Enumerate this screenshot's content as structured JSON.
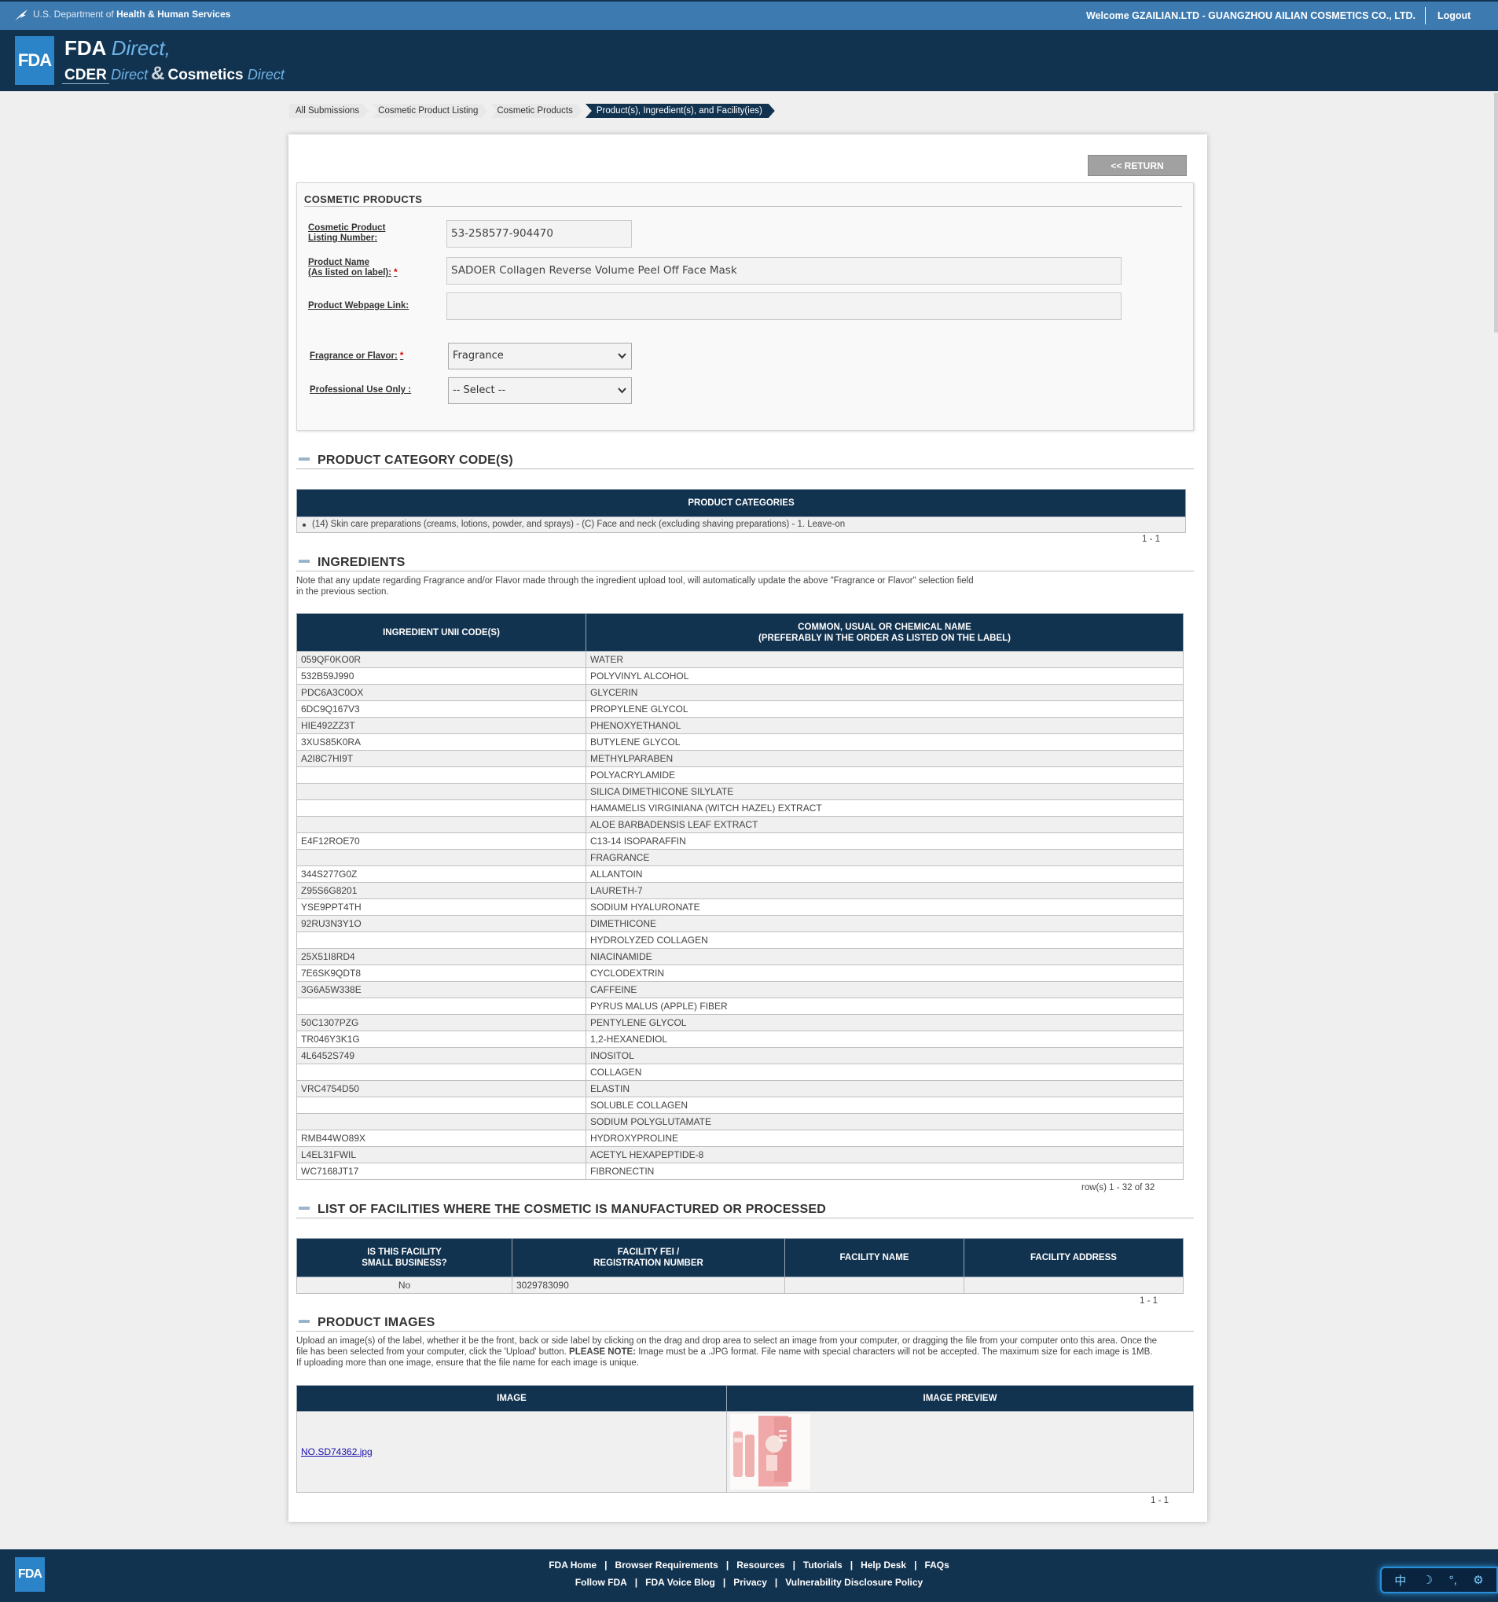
{
  "header": {
    "agency": "U.S. Department of",
    "agency_bold": "Health & Human Services",
    "welcome": "Welcome GZAILIAN.LTD - GUANGZHOU AILIAN COSMETICS CO., LTD.",
    "logout": "Logout"
  },
  "brand": {
    "logo": "FDA",
    "fda": "FDA",
    "direct": "Direct,",
    "cder": "CDER",
    "direct2": "Direct",
    "amp": "&",
    "cosmetics": "Cosmetics",
    "direct3": "Direct"
  },
  "breadcrumb": [
    "All Submissions",
    "Cosmetic Product Listing",
    "Cosmetic Products",
    "Product(s), Ingredient(s), and Facility(ies)"
  ],
  "return_label": "<< RETURN",
  "cosmetic_products": {
    "title": "COSMETIC PRODUCTS",
    "listing_label_1": "Cosmetic Product",
    "listing_label_2": "Listing Number:",
    "listing_value": "53-258577-904470",
    "name_label_1": "Product Name",
    "name_label_2": "(As listed on label):",
    "name_value": "SADOER Collagen Reverse Volume Peel Off Face Mask",
    "webpage_label": "Product Webpage Link:",
    "webpage_value": "",
    "fragrance_label": "Fragrance or Flavor:",
    "fragrance_value": "Fragrance",
    "professional_label": "Professional Use Only :",
    "professional_value": "-- Select --",
    "required_mark": "*"
  },
  "category": {
    "heading": "PRODUCT CATEGORY CODE(S)",
    "col_header": "PRODUCT CATEGORIES",
    "item": "(14) Skin care preparations (creams, lotions, powder, and sprays) - (C) Face and neck (excluding shaving preparations) - 1. Leave-on",
    "pager": "1 - 1"
  },
  "ingredients": {
    "heading": "INGREDIENTS",
    "note_1": "Note that any update regarding Fragrance and/or Flavor made through the ingredient upload tool, will automatically update the above \"Fragrance or Flavor\" selection field",
    "note_2": "in the previous section.",
    "col1": "INGREDIENT UNII CODE(S)",
    "col2_1": "COMMON, USUAL OR CHEMICAL NAME",
    "col2_2": "(PREFERABLY IN THE ORDER AS LISTED ON THE LABEL)",
    "rows": [
      [
        "059QF0KO0R",
        "WATER"
      ],
      [
        "532B59J990",
        "POLYVINYL ALCOHOL"
      ],
      [
        "PDC6A3C0OX",
        "GLYCERIN"
      ],
      [
        "6DC9Q167V3",
        "PROPYLENE GLYCOL"
      ],
      [
        "HIE492ZZ3T",
        "PHENOXYETHANOL"
      ],
      [
        "3XUS85K0RA",
        "BUTYLENE GLYCOL"
      ],
      [
        "A2I8C7HI9T",
        "METHYLPARABEN"
      ],
      [
        "",
        "POLYACRYLAMIDE"
      ],
      [
        "",
        "SILICA DIMETHICONE SILYLATE"
      ],
      [
        "",
        "HAMAMELIS VIRGINIANA (WITCH HAZEL) EXTRACT"
      ],
      [
        "",
        "ALOE BARBADENSIS LEAF EXTRACT"
      ],
      [
        "E4F12ROE70",
        "C13-14 ISOPARAFFIN"
      ],
      [
        "",
        "FRAGRANCE"
      ],
      [
        "344S277G0Z",
        "ALLANTOIN"
      ],
      [
        "Z95S6G8201",
        "LAURETH-7"
      ],
      [
        "YSE9PPT4TH",
        "SODIUM HYALURONATE"
      ],
      [
        "92RU3N3Y1O",
        "DIMETHICONE"
      ],
      [
        "",
        "HYDROLYZED COLLAGEN"
      ],
      [
        "25X51I8RD4",
        "NIACINAMIDE"
      ],
      [
        "7E6SK9QDT8",
        "CYCLODEXTRIN"
      ],
      [
        "3G6A5W338E",
        "CAFFEINE"
      ],
      [
        "",
        "PYRUS MALUS (APPLE) FIBER"
      ],
      [
        "50C1307PZG",
        "PENTYLENE GLYCOL"
      ],
      [
        "TR046Y3K1G",
        "1,2-HEXANEDIOL"
      ],
      [
        "4L6452S749",
        "INOSITOL"
      ],
      [
        "",
        "COLLAGEN"
      ],
      [
        "VRC4754D50",
        "ELASTIN"
      ],
      [
        "",
        "SOLUBLE COLLAGEN"
      ],
      [
        "",
        "SODIUM POLYGLUTAMATE"
      ],
      [
        "RMB44WO89X",
        "HYDROXYPROLINE"
      ],
      [
        "L4EL31FWIL",
        "ACETYL HEXAPEPTIDE-8"
      ],
      [
        "WC7168JT17",
        "FIBRONECTIN"
      ]
    ],
    "pager": "row(s) 1 - 32 of 32"
  },
  "facilities": {
    "heading": "LIST OF FACILITIES WHERE THE COSMETIC IS MANUFACTURED OR PROCESSED",
    "col1_1": "IS THIS FACILITY",
    "col1_2": "SMALL BUSINESS?",
    "col2_1": "FACILITY FEI /",
    "col2_2": "REGISTRATION NUMBER",
    "col3": "FACILITY NAME",
    "col4": "FACILITY ADDRESS",
    "row": {
      "small_business": "No",
      "fei": "3029783090",
      "name": "",
      "address": ""
    },
    "pager": "1 - 1"
  },
  "images": {
    "heading": "PRODUCT IMAGES",
    "note_1": "Upload an image(s) of the label, whether it be the front, back or side label by clicking on the drag and drop area to select an image from your computer, or dragging the file from your computer onto this area. Once the",
    "note_2a": "file has been selected from your computer, click the 'Upload' button. ",
    "note_2b": "PLEASE NOTE:",
    "note_2c": " Image must be a .JPG format. File name with special characters will not be accepted. The maximum size for each image is 1MB.",
    "note_3": "If uploading more than one image, ensure that the file name for each image is unique.",
    "col1": "IMAGE",
    "col2": "IMAGE PREVIEW",
    "file": "NO.SD74362.jpg",
    "pager": "1 - 1"
  },
  "footer": {
    "logo": "FDA",
    "links_1": [
      "FDA Home",
      "Browser Requirements",
      "Resources",
      "Tutorials",
      "Help Desk",
      "FAQs"
    ],
    "links_2": [
      "Follow FDA",
      "FDA Voice Blog",
      "Privacy",
      "Vulnerability Disclosure Policy"
    ],
    "separator": "|"
  },
  "ime": {
    "lang": "中",
    "moon": "☽",
    "punct": "°,",
    "gear": "⚙"
  },
  "colors": {
    "navy": "#123350",
    "topbar": "#3d7ab0",
    "fda_blue": "#2c84c8"
  }
}
